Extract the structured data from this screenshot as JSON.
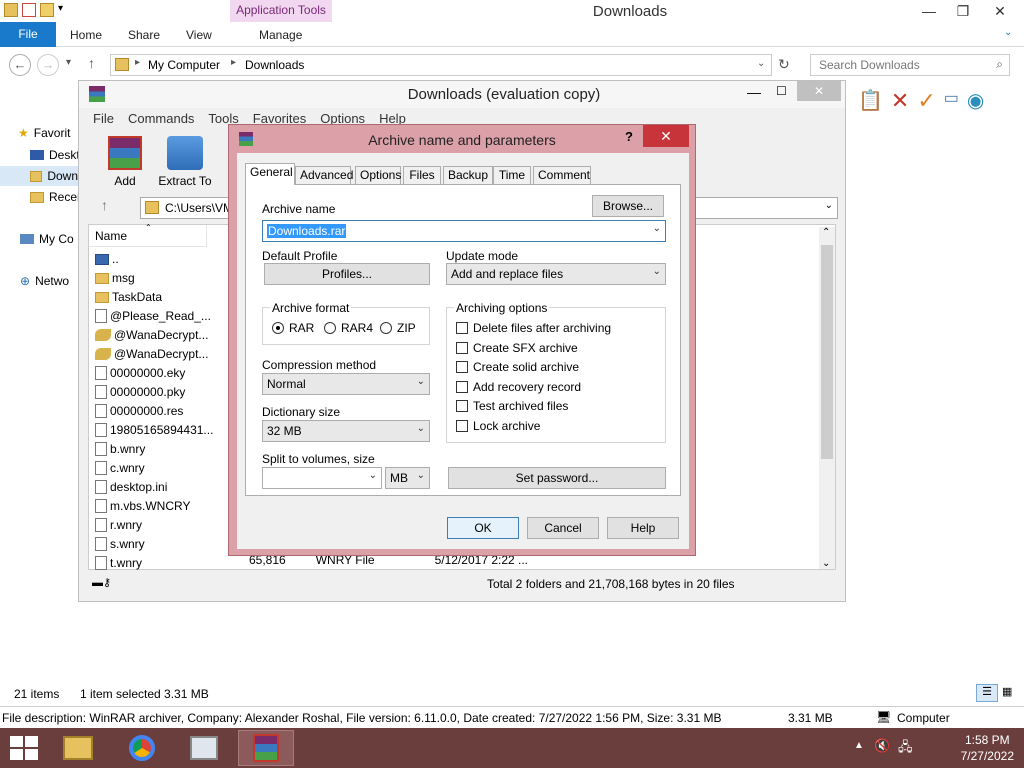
{
  "explorer": {
    "app_tools_label": "Application Tools",
    "title": "Downloads",
    "ribbon_tabs": [
      "File",
      "Home",
      "Share",
      "View",
      "Manage"
    ],
    "breadcrumb": [
      "My Computer",
      "Downloads"
    ],
    "search_placeholder": "Search Downloads",
    "nav_items": [
      "Favorit",
      "Deskt",
      "Down",
      "Recer",
      "My Co",
      "Netwo"
    ],
    "status_items": "21 items",
    "status_selected": "1 item selected  3.31 MB",
    "details": "File description: WinRAR archiver, Company: Alexander Roshal, File version: 6.11.0.0, Date created: 7/27/2022 1:56 PM, Size: 3.31 MB",
    "details_size": "3.31 MB",
    "details_location": "Computer"
  },
  "winrar": {
    "title": "Downloads (evaluation copy)",
    "menu": [
      "File",
      "Commands",
      "Tools",
      "Favorites",
      "Options",
      "Help"
    ],
    "tools": [
      "Add",
      "Extract To"
    ],
    "path": "C:\\Users\\VM",
    "column_name": "Name",
    "files": [
      {
        "name": "..",
        "type": "up"
      },
      {
        "name": "msg",
        "type": "folder"
      },
      {
        "name": "TaskData",
        "type": "folder"
      },
      {
        "name": "@Please_Read_...",
        "type": "file"
      },
      {
        "name": "@WanaDecrypt...",
        "type": "exe"
      },
      {
        "name": "@WanaDecrypt...",
        "type": "exe"
      },
      {
        "name": "00000000.eky",
        "type": "file"
      },
      {
        "name": "00000000.pky",
        "type": "file"
      },
      {
        "name": "00000000.res",
        "type": "file"
      },
      {
        "name": "19805165894431...",
        "type": "file"
      },
      {
        "name": "b.wnry",
        "type": "file"
      },
      {
        "name": "c.wnry",
        "type": "file"
      },
      {
        "name": "desktop.ini",
        "type": "file"
      },
      {
        "name": "m.vbs.WNCRY",
        "type": "file"
      },
      {
        "name": "r.wnry",
        "type": "file"
      },
      {
        "name": "s.wnry",
        "type": "file"
      },
      {
        "name": "t.wnry",
        "type": "file"
      }
    ],
    "last_row_size": "65,816",
    "last_row_type": "WNRY File",
    "last_row_date": "5/12/2017 2:22 ...",
    "status_total": "Total 2 folders and 21,708,168 bytes in 20 files"
  },
  "dialog": {
    "title": "Archive name and parameters",
    "help_mark": "?",
    "close": "✕",
    "tabs": [
      "General",
      "Advanced",
      "Options",
      "Files",
      "Backup",
      "Time",
      "Comment"
    ],
    "archive_name_label": "Archive name",
    "browse": "Browse...",
    "archive_name_value": "Downloads.rar",
    "default_profile_label": "Default Profile",
    "profiles_button": "Profiles...",
    "update_mode_label": "Update mode",
    "update_mode_value": "Add and replace files",
    "archive_format_label": "Archive format",
    "formats": [
      "RAR",
      "RAR4",
      "ZIP"
    ],
    "selected_format": "RAR",
    "archiving_options_label": "Archiving options",
    "options": [
      "Delete files after archiving",
      "Create SFX archive",
      "Create solid archive",
      "Add recovery record",
      "Test archived files",
      "Lock archive"
    ],
    "compression_label": "Compression method",
    "compression_value": "Normal",
    "dictionary_label": "Dictionary size",
    "dictionary_value": "32 MB",
    "split_label": "Split to volumes, size",
    "split_value": "",
    "split_unit": "MB",
    "set_password": "Set password...",
    "ok": "OK",
    "cancel": "Cancel",
    "help": "Help"
  },
  "taskbar": {
    "time": "1:58 PM",
    "date": "7/27/2022"
  }
}
